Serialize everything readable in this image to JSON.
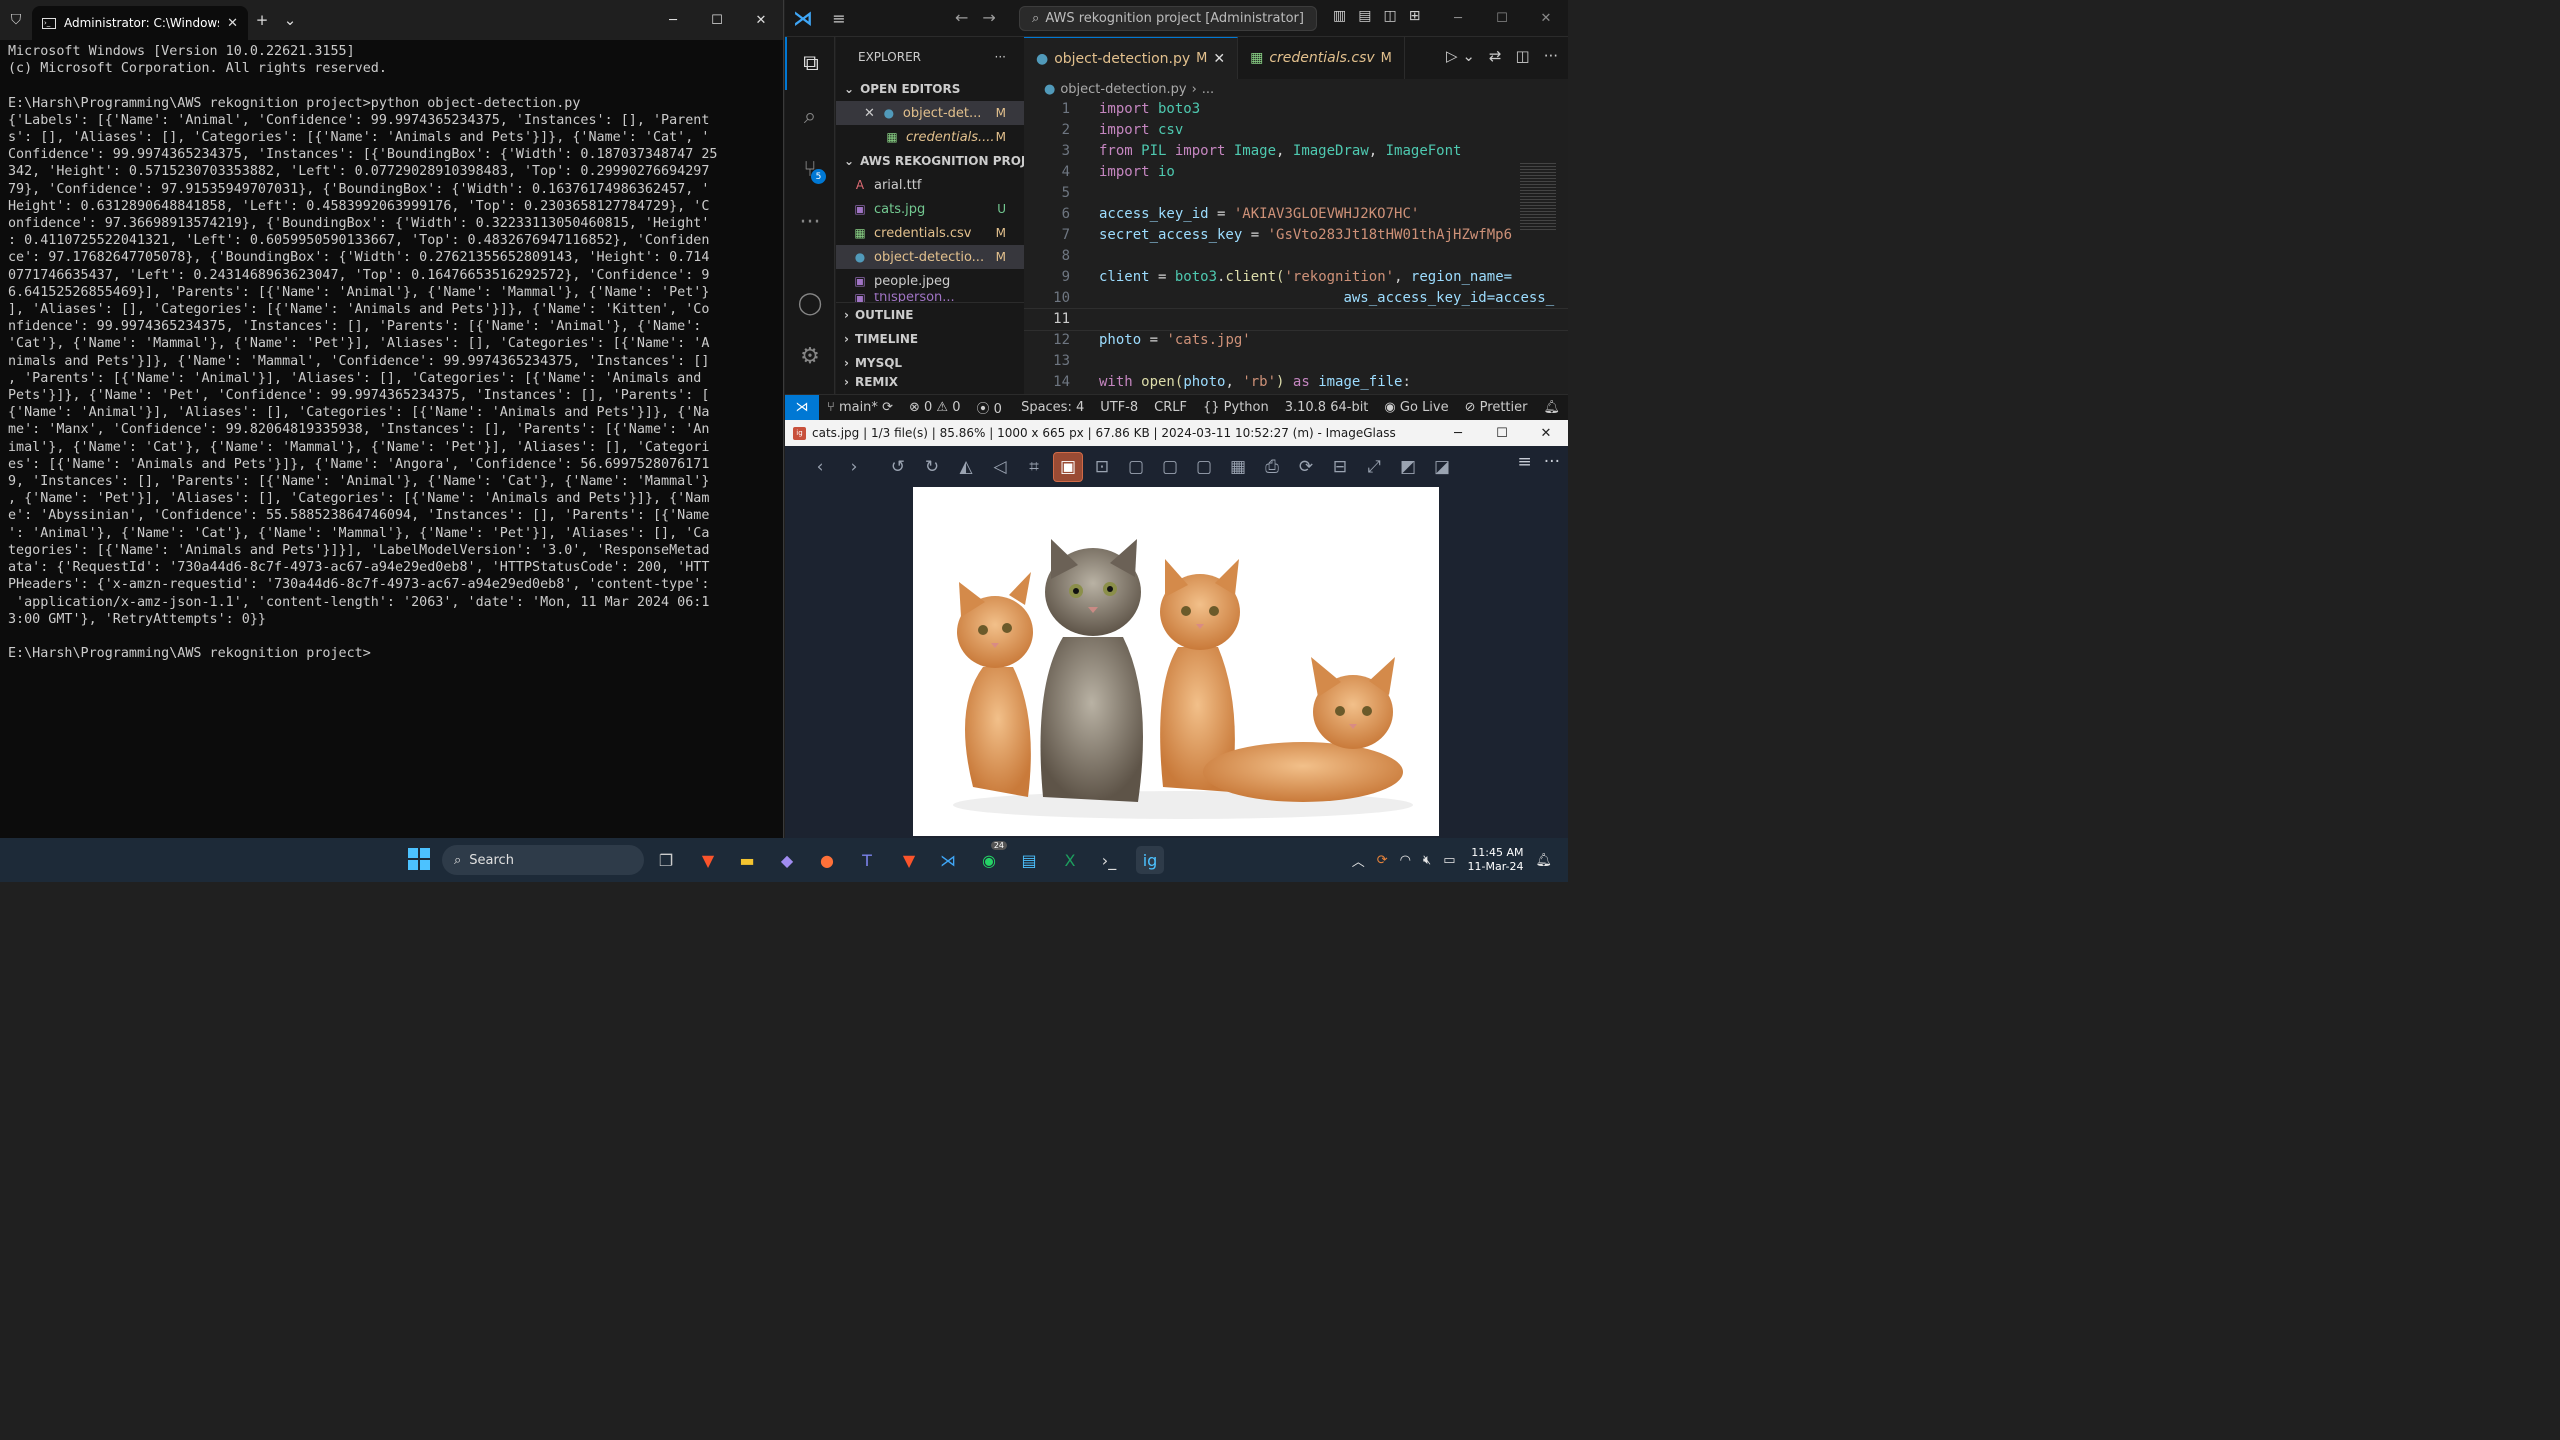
{
  "terminal": {
    "tab_title": "Administrator: C:\\Windows\\Sy",
    "new_tab": "+",
    "dropdown": "⌄",
    "output": "Microsoft Windows [Version 10.0.22621.3155]\n(c) Microsoft Corporation. All rights reserved.\n\nE:\\Harsh\\Programming\\AWS rekognition project>python object-detection.py\n{'Labels': [{'Name': 'Animal', 'Confidence': 99.9974365234375, 'Instances': [], 'Parent\ns': [], 'Aliases': [], 'Categories': [{'Name': 'Animals and Pets'}]}, {'Name': 'Cat', '\nConfidence': 99.9974365234375, 'Instances': [{'BoundingBox': {'Width': 0.187037348747 25\n342, 'Height': 0.5715230703353882, 'Left': 0.07729028910398483, 'Top': 0.29990276694297\n79}, 'Confidence': 97.91535949707031}, {'BoundingBox': {'Width': 0.16376174986362457, '\nHeight': 0.6312890648841858, 'Left': 0.4583992063999176, 'Top': 0.2303658127784729}, 'C\nonfidence': 97.36698913574219}, {'BoundingBox': {'Width': 0.32233113050460815, 'Height'\n: 0.4110725522041321, 'Left': 0.6059950590133667, 'Top': 0.4832676947116852}, 'Confiden\nce': 97.17682647705078}, {'BoundingBox': {'Width': 0.27621355652809143, 'Height': 0.714\n0771746635437, 'Left': 0.2431468963623047, 'Top': 0.16476653516292572}, 'Confidence': 9\n6.64152526855469}], 'Parents': [{'Name': 'Animal'}, {'Name': 'Mammal'}, {'Name': 'Pet'}\n], 'Aliases': [], 'Categories': [{'Name': 'Animals and Pets'}]}, {'Name': 'Kitten', 'Co\nnfidence': 99.9974365234375, 'Instances': [], 'Parents': [{'Name': 'Animal'}, {'Name':\n'Cat'}, {'Name': 'Mammal'}, {'Name': 'Pet'}], 'Aliases': [], 'Categories': [{'Name': 'A\nnimals and Pets'}]}, {'Name': 'Mammal', 'Confidence': 99.9974365234375, 'Instances': []\n, 'Parents': [{'Name': 'Animal'}], 'Aliases': [], 'Categories': [{'Name': 'Animals and\nPets'}]}, {'Name': 'Pet', 'Confidence': 99.9974365234375, 'Instances': [], 'Parents': [\n{'Name': 'Animal'}], 'Aliases': [], 'Categories': [{'Name': 'Animals and Pets'}]}, {'Na\nme': 'Manx', 'Confidence': 99.82064819335938, 'Instances': [], 'Parents': [{'Name': 'An\nimal'}, {'Name': 'Cat'}, {'Name': 'Mammal'}, {'Name': 'Pet'}], 'Aliases': [], 'Categori\nes': [{'Name': 'Animals and Pets'}]}, {'Name': 'Angora', 'Confidence': 56.6997528076171\n9, 'Instances': [], 'Parents': [{'Name': 'Animal'}, {'Name': 'Cat'}, {'Name': 'Mammal'}\n, {'Name': 'Pet'}], 'Aliases': [], 'Categories': [{'Name': 'Animals and Pets'}]}, {'Nam\ne': 'Abyssinian', 'Confidence': 55.588523864746094, 'Instances': [], 'Parents': [{'Name\n': 'Animal'}, {'Name': 'Cat'}, {'Name': 'Mammal'}, {'Name': 'Pet'}], 'Aliases': [], 'Ca\ntegories': [{'Name': 'Animals and Pets'}]}], 'LabelModelVersion': '3.0', 'ResponseMetad\nata': {'RequestId': '730a44d6-8c7f-4973-ac67-a94e29ed0eb8', 'HTTPStatusCode': 200, 'HTT\nPHeaders': {'x-amzn-requestid': '730a44d6-8c7f-4973-ac67-a94e29ed0eb8', 'content-type':\n 'application/x-amz-json-1.1', 'content-length': '2063', 'date': 'Mon, 11 Mar 2024 06:1\n3:00 GMT'}, 'RetryAttempts': 0}}\n\nE:\\Harsh\\Programming\\AWS rekognition project>"
  },
  "vscode": {
    "search": "AWS rekognition project [Administrator]",
    "explorer_title": "EXPLORER",
    "explorer_more": "···",
    "open_editors": "OPEN EDITORS",
    "open_files": [
      {
        "name": "object-det...",
        "status": "M"
      },
      {
        "name": "credentials....",
        "status": "M"
      }
    ],
    "project": "AWS REKOGNITION PROJE...",
    "files": [
      {
        "name": "arial.ttf",
        "status": ""
      },
      {
        "name": "cats.jpg",
        "status": "U"
      },
      {
        "name": "credentials.csv",
        "status": "M"
      },
      {
        "name": "object-detectio...",
        "status": "M"
      },
      {
        "name": "people.jpeg",
        "status": ""
      },
      {
        "name": "thisperson...",
        "status": ""
      }
    ],
    "sections": {
      "outline": "OUTLINE",
      "timeline": "TIMELINE",
      "mysql": "MYSQL",
      "remix": "REMIX"
    },
    "source_control_badge": "5",
    "tabs": [
      {
        "label": "object-detection.py",
        "status": "M"
      },
      {
        "label": "credentials.csv",
        "status": "M"
      }
    ],
    "breadcrumb": "object-detection.py",
    "breadcrumb_more": "...",
    "line_numbers": [
      "1",
      "2",
      "3",
      "4",
      "5",
      "6",
      "7",
      "8",
      "9",
      "10",
      "11",
      "12",
      "13",
      "14"
    ],
    "code": {
      "l1_kw": "import",
      "l1_mod": " boto3",
      "l2_kw": "import",
      "l2_mod": " csv",
      "l3_kw1": "from",
      "l3_mod": " PIL ",
      "l3_kw2": "import",
      "l3_c1": " Image",
      "l3_s1": ", ",
      "l3_c2": "ImageDraw",
      "l3_s2": ", ",
      "l3_c3": "ImageFont",
      "l4_kw": "import",
      "l4_mod": " io",
      "l6_id": "access_key_id",
      "l6_op": " = ",
      "l6_str": "'AKIAV3GLOEVWHJ2KO7HC'",
      "l7_id": "secret_access_key",
      "l7_op": " = ",
      "l7_str": "'GsVto283Jt18tHW01thAjHZwfMp6",
      "l9_id": "client",
      "l9_op": " = ",
      "l9_mod": "boto3",
      "l9_dot": ".",
      "l9_fn": "client",
      "l9_p": "(",
      "l9_str": "'rekognition'",
      "l9_c": ", ",
      "l9_kw": "region_name=",
      "l10_pad": "                             ",
      "l10_kw": "aws_access_key_id=access_",
      "l12_id": "photo",
      "l12_op": " = ",
      "l12_str": "'cats.jpg'",
      "l14_kw": "with",
      "l14_fn": " open",
      "l14_p1": "(",
      "l14_id": "photo",
      "l14_c": ", ",
      "l14_str": "'rb'",
      "l14_p2": ") ",
      "l14_as": "as",
      "l14_var": " image_file",
      "l14_col": ":"
    },
    "status": {
      "branch": "main*",
      "errors": "0",
      "warnings": "0",
      "ports": "0",
      "spaces": "Spaces: 4",
      "encoding": "UTF-8",
      "eol": "CRLF",
      "language": "Python",
      "interpreter": "3.10.8 64-bit",
      "golive": "Go Live",
      "prettier": "Prettier"
    }
  },
  "imageglass": {
    "title": "cats.jpg  |  1/3 file(s)  |  85.86%  |  1000 x 665 px  |  67.86 KB  |  2024-03-11 10:52:27 (m)  - ImageGlass",
    "app_icon": "ig"
  },
  "taskbar": {
    "search": "Search",
    "whatsapp_badge": "24",
    "time": "11:45 AM",
    "date": "11-Mar-24"
  }
}
